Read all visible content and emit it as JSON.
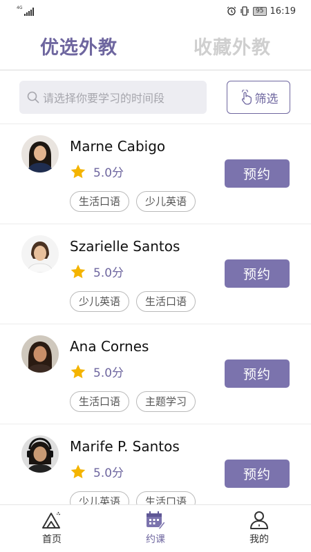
{
  "status_bar": {
    "network": "4G",
    "battery": "95",
    "time": "16:19"
  },
  "tabs": [
    {
      "label": "优选外教",
      "active": true
    },
    {
      "label": "收藏外教",
      "active": false
    }
  ],
  "search": {
    "placeholder": "请选择你要学习的时间段",
    "icon": "search-icon"
  },
  "filter": {
    "label": "筛选",
    "icon": "tap-hand-icon"
  },
  "teachers": [
    {
      "name": "Marne Cabigo",
      "rating": "5.0分",
      "tags": [
        "生活口语",
        "少儿英语"
      ],
      "book_label": "预约"
    },
    {
      "name": "Szarielle Santos",
      "rating": "5.0分",
      "tags": [
        "少儿英语",
        "生活口语"
      ],
      "book_label": "预约"
    },
    {
      "name": "Ana Cornes",
      "rating": "5.0分",
      "tags": [
        "生活口语",
        "主题学习"
      ],
      "book_label": "预约"
    },
    {
      "name": "Marife P. Santos",
      "rating": "5.0分",
      "tags": [
        "少儿英语",
        "生活口语"
      ],
      "book_label": "预约"
    }
  ],
  "bottom_nav": [
    {
      "label": "首页",
      "icon": "home-mountain-icon",
      "active": false
    },
    {
      "label": "约课",
      "icon": "calendar-icon",
      "active": true
    },
    {
      "label": "我的",
      "icon": "profile-icon",
      "active": false
    }
  ],
  "colors": {
    "accent": "#6e669f",
    "button": "#7b73ad",
    "star": "#f4b400",
    "inactive_tab": "#cfcfcf"
  }
}
